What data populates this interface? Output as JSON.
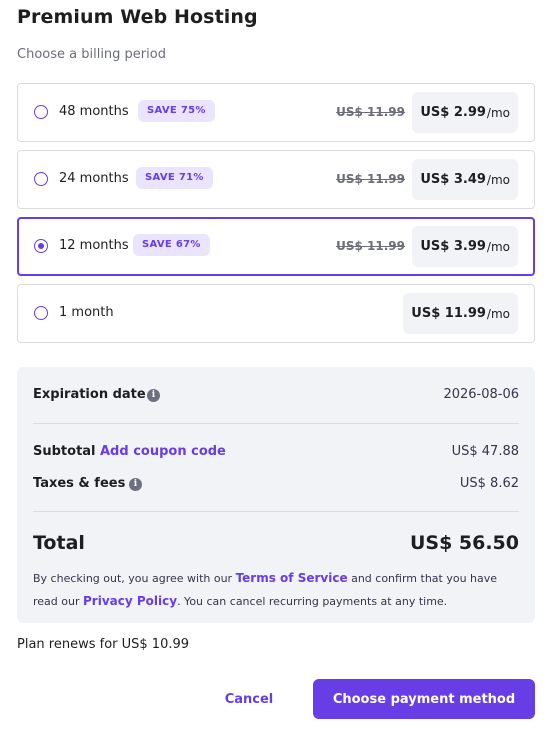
{
  "header": {
    "title": "Premium Web Hosting",
    "subtitle": "Choose a billing period"
  },
  "plans": [
    {
      "label": "48 months",
      "badge": "SAVE 75%",
      "old_price": "US$ 11.99",
      "price": "US$ 2.99",
      "unit": "/mo",
      "selected": false
    },
    {
      "label": "24 months",
      "badge": "SAVE 71%",
      "old_price": "US$ 11.99",
      "price": "US$ 3.49",
      "unit": "/mo",
      "selected": false
    },
    {
      "label": "12 months",
      "badge": "SAVE 67%",
      "old_price": "US$ 11.99",
      "price": "US$ 3.99",
      "unit": "/mo",
      "selected": true
    },
    {
      "label": "1 month",
      "badge": "",
      "old_price": "",
      "price": "US$ 11.99",
      "unit": "/mo",
      "selected": false
    }
  ],
  "summary": {
    "expiration_label": "Expiration date",
    "expiration_value": "2026-08-06",
    "subtotal_label": "Subtotal",
    "coupon_link": "Add coupon code",
    "subtotal_value": "US$ 47.88",
    "taxes_label": "Taxes & fees",
    "taxes_value": "US$ 8.62",
    "total_label": "Total",
    "total_value": "US$ 56.50",
    "legal_prefix": "By checking out, you agree with our ",
    "terms_link": "Terms of Service",
    "legal_middle": " and confirm that you have read our ",
    "privacy_link": "Privacy Policy",
    "legal_suffix": ". You can cancel recurring payments at any time."
  },
  "footer": {
    "renews_text": "Plan renews for US$ 10.99",
    "cancel_label": "Cancel",
    "cta_label": "Choose payment method"
  },
  "colors": {
    "accent": "#673de6",
    "badge_bg": "#ebe4ff",
    "summary_bg": "#f2f3f6"
  },
  "icons": {
    "info": "info-icon"
  }
}
